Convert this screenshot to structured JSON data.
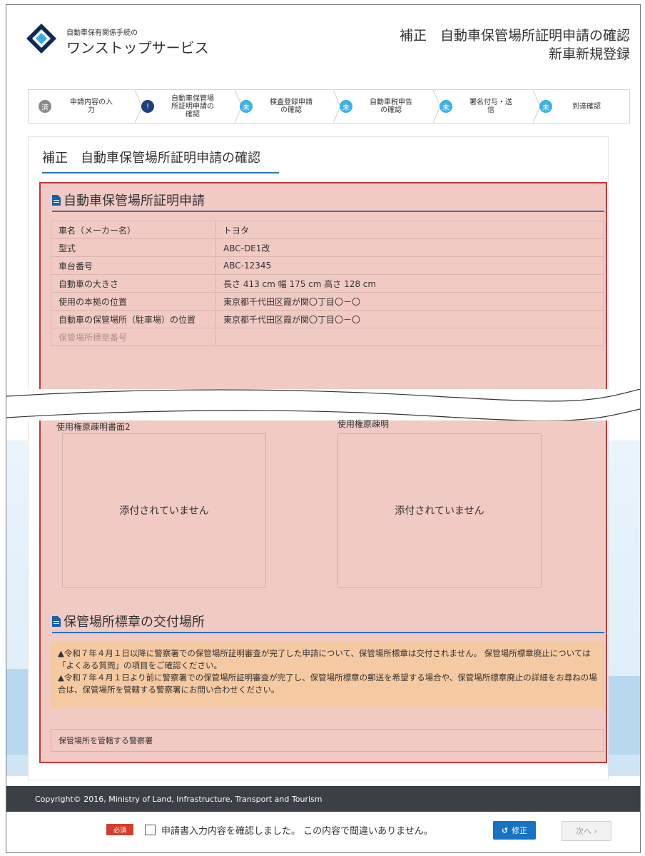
{
  "header": {
    "brand_small": "自動車保有関係手続の",
    "brand_big": "ワンストップサービス",
    "title_line1": "補正　自動車保管場所証明申請の確認",
    "title_line2": "新車新規登録"
  },
  "steps": [
    {
      "badge": "済",
      "label": "申請内容の入\n力",
      "color": "#8a8a8a"
    },
    {
      "badge": "!",
      "label": "自動車保管場\n所証明申請の\n確認",
      "color": "#1f3f7a"
    },
    {
      "badge": "未",
      "label": "検査登録申請\nの確認",
      "color": "#3fb0e4"
    },
    {
      "badge": "未",
      "label": "自動車税申告\nの確認",
      "color": "#3fb0e4"
    },
    {
      "badge": "未",
      "label": "署名付与・送\n信",
      "color": "#3fb0e4"
    },
    {
      "badge": "未",
      "label": "到達確認",
      "color": "#3fb0e4"
    }
  ],
  "panel": {
    "title": "補正　自動車保管場所証明申請の確認"
  },
  "section1": {
    "title": "自動車保管場所証明申請",
    "rows": [
      {
        "label": "車名（メーカー名）",
        "value": "トヨタ"
      },
      {
        "label": "型式",
        "value": "ABC-DE1改"
      },
      {
        "label": "車台番号",
        "value": "ABC-12345"
      },
      {
        "label": "自動車の大きさ",
        "value": "長さ 413 cm  幅 175 cm  高さ 128 cm"
      },
      {
        "label": "使用の本拠の位置",
        "value": "東京都千代田区霞が関〇丁目〇－〇"
      },
      {
        "label": "自動車の保管場所（駐車場）の位置",
        "value": "東京都千代田区霞が関〇丁目〇－〇"
      },
      {
        "label": "保管場所標章番号",
        "value": ""
      }
    ]
  },
  "attachments": [
    {
      "label": "使用権原疎明書面2",
      "empty_text": "添付されていません"
    },
    {
      "label": "使用権原疎明",
      "empty_text": "添付されていません"
    }
  ],
  "section2": {
    "title": "保管場所標章の交付場所",
    "notice_lines": [
      "▲令和７年４月１日以降に警察署での保管場所証明審査が完了した申請について、保管場所標章は交付されません。 保管場所標章廃止については「よくある質問」の項目をご確認ください。",
      "▲令和７年４月１日より前に警察署での保管場所証明審査が完了し、保管場所標章の郵送を希望する場合や、保管場所標章廃止の詳細をお尋ねの場合は、保管場所を管轄する警察署にお問い合わせください。"
    ],
    "police_label": "保管場所を管轄する警察署"
  },
  "footer": {
    "copyright": "Copyright© 2016, Ministry of Land, Infrastructure, Transport and Tourism"
  },
  "bottom": {
    "required_badge": "必須",
    "confirm_text": "申請書入力内容を確認しました。 この内容で間違いありません。",
    "fix_label": "修正",
    "next_label": "次へ ›"
  }
}
